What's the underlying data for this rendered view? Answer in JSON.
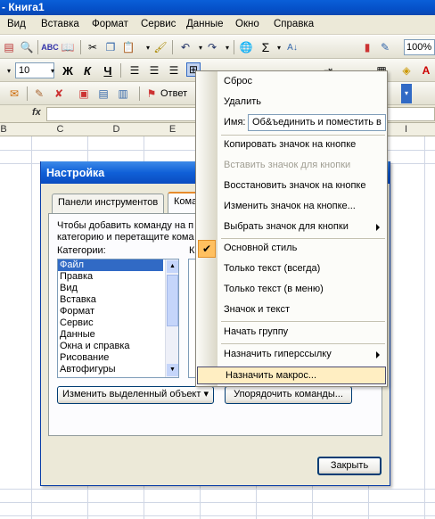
{
  "window": {
    "title": "- Книга1"
  },
  "menubar": [
    "Вид",
    "Вставка",
    "Формат",
    "Сервис",
    "Данные",
    "Окно",
    "Справка"
  ],
  "toolbar": {
    "zoom": "100%",
    "font_size": "10",
    "bold": "Ж",
    "italic": "К",
    "underline": "Ч",
    "sigma": "Σ"
  },
  "reviewing": {
    "reply_label": "Ответ"
  },
  "formula": {
    "fx": "fx"
  },
  "columns": [
    "B",
    "C",
    "D",
    "E",
    "I"
  ],
  "dialog": {
    "title": "Настройка",
    "tabs": [
      "Панели инструментов",
      "Кома"
    ],
    "desc_line1": "Чтобы добавить команду на п",
    "desc_line2": "категорию и перетащите кома",
    "categories_label": "Категории:",
    "commands_label_stub": "К",
    "categories": [
      "Файл",
      "Правка",
      "Вид",
      "Вставка",
      "Формат",
      "Сервис",
      "Данные",
      "Окна и справка",
      "Рисование",
      "Автофигуры"
    ],
    "modify_button": "Изменить выделенный объект",
    "arrange_button": "Упорядочить команды...",
    "close_button": "Закрыть"
  },
  "context_menu": {
    "reset": "Сброс",
    "delete": "Удалить",
    "name_label": "Имя:",
    "name_value": "Об&ъединить и поместить в",
    "copy_icon": "Копировать значок на кнопке",
    "paste_icon": "Вставить значок для кнопки",
    "restore_icon": "Восстановить значок на кнопке",
    "edit_icon": "Изменить значок на кнопке...",
    "choose_icon": "Выбрать значок для кнопки",
    "default_style": "Основной стиль",
    "text_only_always": "Только текст (всегда)",
    "text_only_menu": "Только текст (в меню)",
    "icon_and_text": "Значок и текст",
    "begin_group": "Начать группу",
    "hyperlink": "Назначить гиперссылку",
    "assign_macro": "Назначить макрос..."
  }
}
